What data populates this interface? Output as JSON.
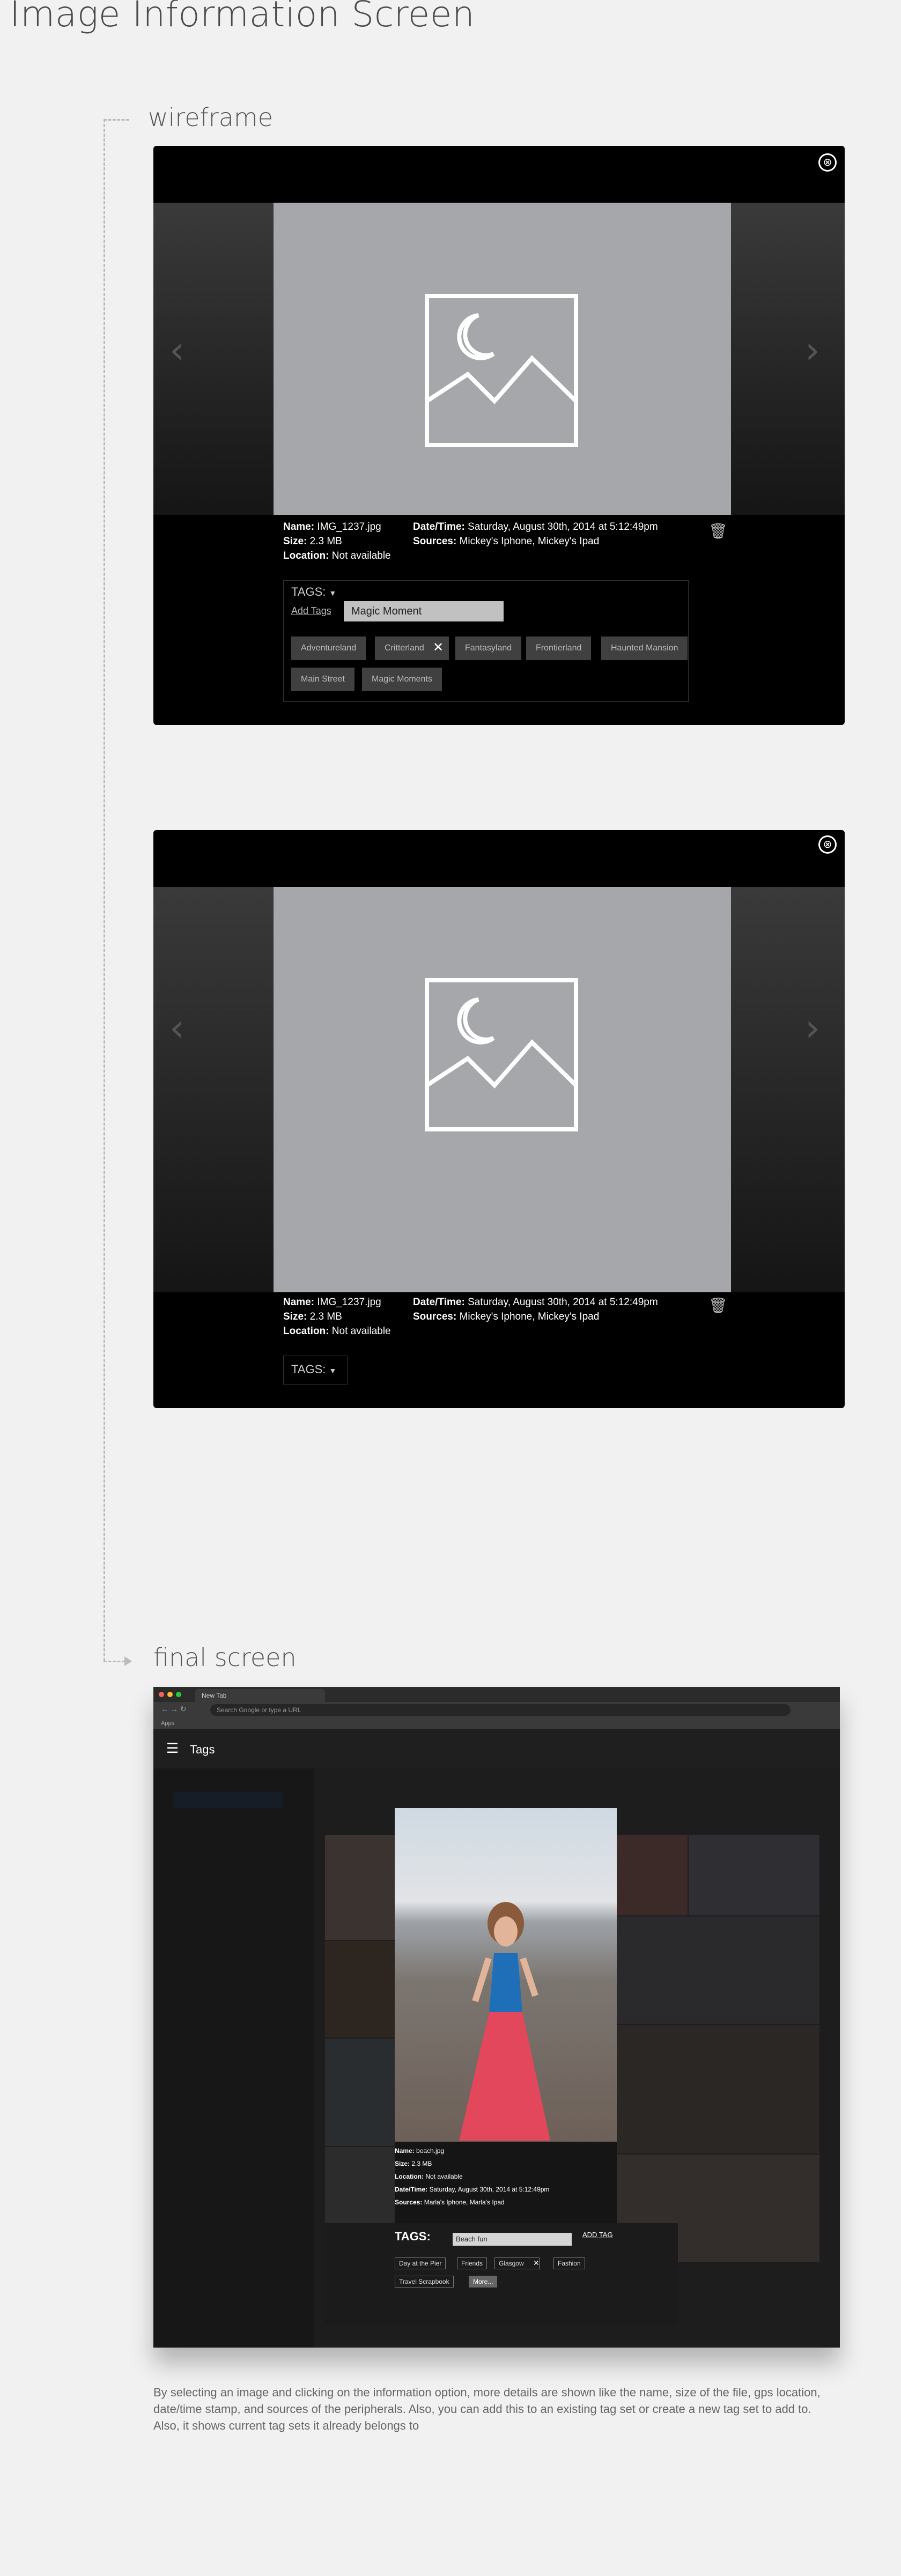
{
  "page": {
    "title": "Image Information Screen"
  },
  "sections": {
    "wireframe": "wireframe",
    "final": "final screen"
  },
  "icons": {
    "close": "⊗",
    "left": "‹",
    "right": "›",
    "trash": "🗑",
    "x": "✕",
    "caret": "▼",
    "menu": "☰"
  },
  "wireframe1": {
    "name_label": "Name:",
    "name": "IMG_1237.jpg",
    "size_label": "Size:",
    "size": "2.3 MB",
    "location_label": "Location:",
    "location": "Not available",
    "datetime_label": "Date/Time:",
    "datetime": "Saturday, August 30th, 2014 at 5:12:49pm",
    "sources_label": "Sources:",
    "sources": "Mickey's Iphone, Mickey's Ipad",
    "tags_label": "TAGS:",
    "add_tags": "Add Tags",
    "tag_input": "Magic Moment",
    "tags": [
      "Adventureland",
      "Critterland",
      "Fantasyland",
      "Frontierland",
      "Haunted Mansion",
      "Main Street",
      "Magic Moments"
    ]
  },
  "wireframe2": {
    "name_label": "Name:",
    "name": "IMG_1237.jpg",
    "size_label": "Size:",
    "size": "2.3 MB",
    "location_label": "Location:",
    "location": "Not available",
    "datetime_label": "Date/Time:",
    "datetime": "Saturday, August 30th, 2014 at 5:12:49pm",
    "sources_label": "Sources:",
    "sources": "Mickey's Iphone, Mickey's Ipad",
    "tags_label": "TAGS:"
  },
  "browser": {
    "tab_title": "New Tab",
    "address_placeholder": "Search Google or type a URL",
    "bookmarks": "Apps",
    "app_title": "Tags"
  },
  "final": {
    "name_label": "Name:",
    "name": "beach.jpg",
    "size_label": "Size:",
    "size": "2.3 MB",
    "location_label": "Location:",
    "location": "Not available",
    "datetime_label": "Date/Time:",
    "datetime": "Saturday, August 30th, 2014 at 5:12:49pm",
    "sources_label": "Sources:",
    "sources": "Marla's Iphone, Marla's Ipad",
    "tags_label": "TAGS:",
    "tag_input": "Beach fun",
    "add_tag": "ADD TAG",
    "tags": [
      "Day at the Pier",
      "Friends",
      "Glasgow",
      "Fashion",
      "Travel Scrapbook",
      "More..."
    ]
  },
  "caption": "By selecting an image and clicking on the information option, more details are shown like the name, size of the file, gps location, date/time stamp, and sources of the peripherals. Also, you can add this to an existing tag set or create a new tag set to add to. Also, it shows current tag sets it already belongs to"
}
